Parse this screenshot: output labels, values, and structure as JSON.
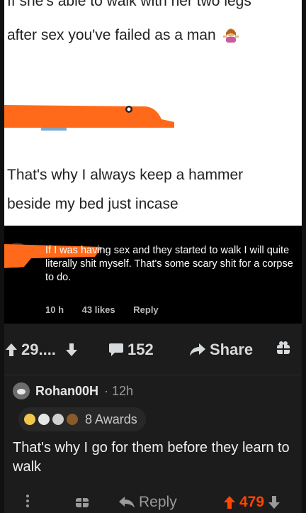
{
  "post": {
    "line1": "If she's able to walk with her two legs",
    "line2": "after sex you've failed as a man",
    "line3": "That's why I always keep a hammer",
    "line4": "beside my bed just incase"
  },
  "comment_card": {
    "text": "If I was having sex and they started to walk I will quite literally shit myself. That's some scary shit for a corpse to do.",
    "time": "10 h",
    "likes": "43 likes",
    "reply": "Reply"
  },
  "post_actions": {
    "upvotes": "29....",
    "comments": "152",
    "share": "Share"
  },
  "reddit_comment": {
    "username": "Rohan00H",
    "time": "· 12h",
    "awards": "8 Awards",
    "text": "That's why I go for them before they learn to walk",
    "reply": "Reply",
    "score": "479"
  },
  "colors": {
    "redaction": "#ff6a1a",
    "upvote_active": "#ff4500",
    "dark_bg": "#1c1c1c"
  }
}
